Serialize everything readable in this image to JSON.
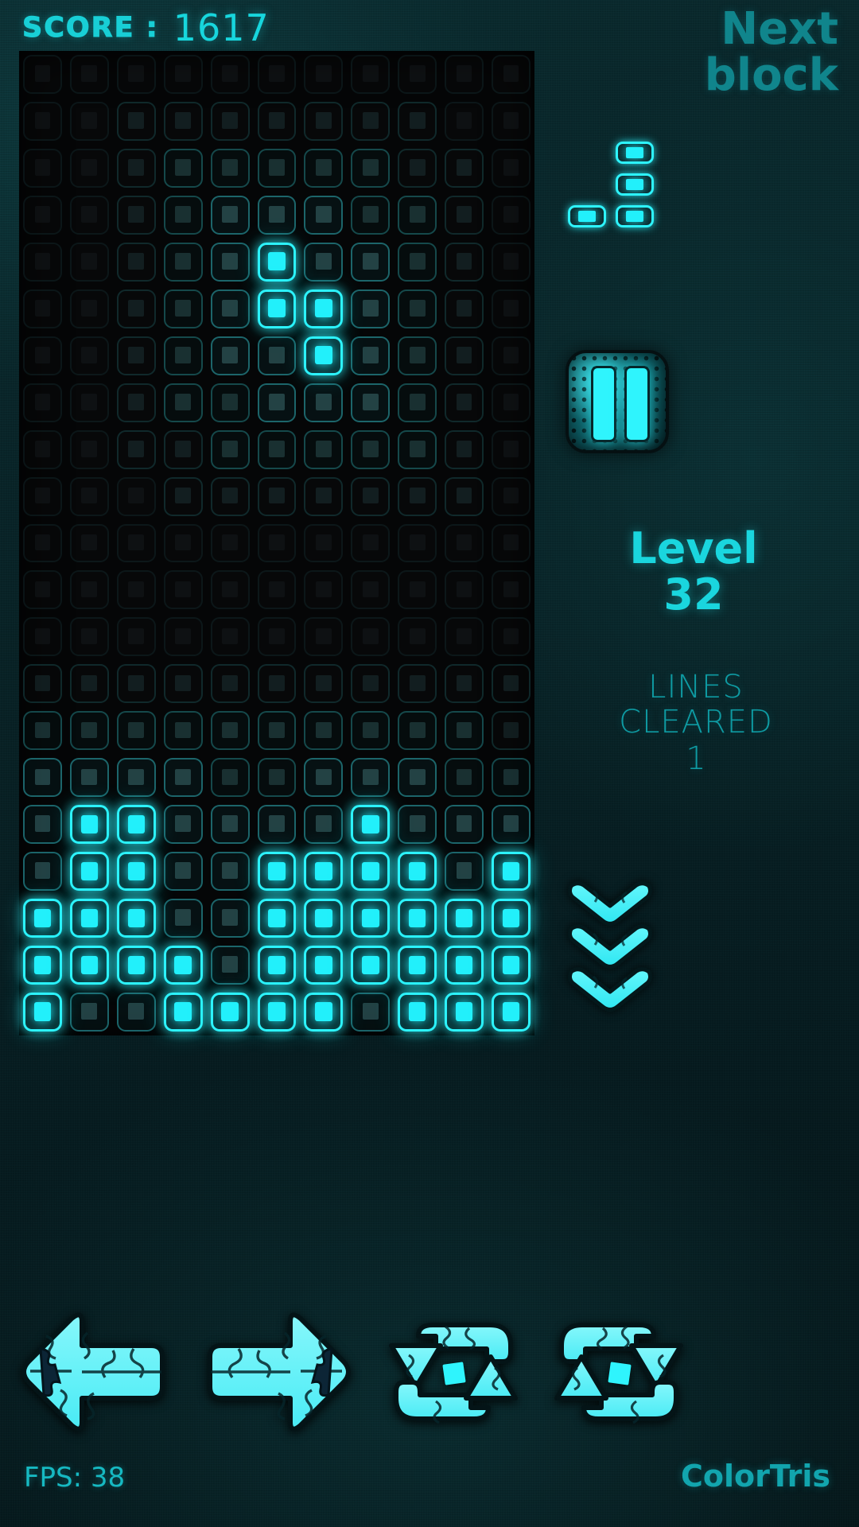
{
  "app": {
    "brand": "ColorTris"
  },
  "hud": {
    "score_label": "SCORE :",
    "score_value": "1617",
    "fps_text": "FPS: 38"
  },
  "next": {
    "title_line1": "Next",
    "title_line2": "block",
    "piece_name": "J-piece",
    "piece_cells": [
      [
        0,
        1
      ],
      [
        1,
        1
      ],
      [
        2,
        0
      ],
      [
        2,
        1
      ]
    ]
  },
  "pause": {
    "label": "pause-button"
  },
  "level": {
    "label": "Level",
    "value": "32"
  },
  "lines": {
    "label_line1": "LINES",
    "label_line2": "CLEARED",
    "value": "1"
  },
  "controls": {
    "move_left": "move-left",
    "move_right": "move-right",
    "rotate_ccw": "rotate-counter-clockwise",
    "rotate_cw": "rotate-clockwise",
    "soft_drop": "soft-drop"
  },
  "colors": {
    "accent_cyan": "#22f0fb",
    "border_cyan": "#2ff4fd",
    "heading_teal": "#10858c",
    "level_teal": "#1ad6de",
    "lines_teal": "#0e9aa2",
    "background": "#082226"
  },
  "board": {
    "columns": 11,
    "rows": 21,
    "active_piece_cells": [
      [
        4,
        5
      ],
      [
        5,
        5
      ],
      [
        5,
        6
      ],
      [
        6,
        6
      ]
    ],
    "locked_cells": [
      [
        16,
        1
      ],
      [
        16,
        2
      ],
      [
        16,
        7
      ],
      [
        17,
        1
      ],
      [
        17,
        2
      ],
      [
        17,
        5
      ],
      [
        17,
        6
      ],
      [
        17,
        7
      ],
      [
        17,
        8
      ],
      [
        17,
        10
      ],
      [
        18,
        0
      ],
      [
        18,
        1
      ],
      [
        18,
        2
      ],
      [
        18,
        5
      ],
      [
        18,
        6
      ],
      [
        18,
        7
      ],
      [
        18,
        8
      ],
      [
        18,
        9
      ],
      [
        18,
        10
      ],
      [
        19,
        0
      ],
      [
        19,
        1
      ],
      [
        19,
        2
      ],
      [
        19,
        3
      ],
      [
        19,
        5
      ],
      [
        19,
        6
      ],
      [
        19,
        7
      ],
      [
        19,
        8
      ],
      [
        19,
        9
      ],
      [
        19,
        10
      ],
      [
        20,
        0
      ],
      [
        20,
        3
      ],
      [
        20,
        4
      ],
      [
        20,
        5
      ],
      [
        20,
        6
      ],
      [
        20,
        8
      ],
      [
        20,
        9
      ],
      [
        20,
        10
      ]
    ]
  }
}
